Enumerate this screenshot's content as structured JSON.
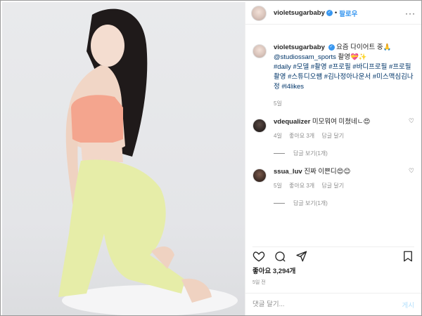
{
  "header": {
    "username": "violetsugarbaby",
    "follow_label": "팔로우",
    "more_label": "···"
  },
  "caption": {
    "username": "violetsugarbaby",
    "text_1": "요즘 다이어트 중🙏",
    "mention": "@studiossam_sports",
    "text_2": "촬영💝✨",
    "hashtags": "#daily #모델 #촬영 #프로필 #바디프로필 #프로필촬영 #스튜디오쌤 #김나정아나운서 #미스맥심김나정 #l4likes",
    "time": "5일"
  },
  "comments": [
    {
      "username": "vdequalizer",
      "text": "미모뭐여 미쳤네ㄴ😍",
      "time": "4일",
      "likes": "좋아요 3개",
      "reply": "답글 달기",
      "view_replies": "답글 보기(1개)"
    },
    {
      "username": "ssua_luv",
      "text": "진짜 이쁜디😍😊",
      "time": "5일",
      "likes": "좋아요 3개",
      "reply": "답글 달기",
      "view_replies": "답글 보기(1개)"
    }
  ],
  "likes_count": "좋아요 3,294개",
  "post_date": "5일 전",
  "composer": {
    "placeholder": "댓글 달기...",
    "post_label": "게시"
  },
  "icons": [
    "verified-badge-icon",
    "heart-icon",
    "comment-icon",
    "share-icon",
    "bookmark-icon",
    "more-icon"
  ],
  "colors": {
    "link": "#3897f0",
    "hashtag": "#003569",
    "muted": "#8e8e8e",
    "border": "#efefef"
  }
}
